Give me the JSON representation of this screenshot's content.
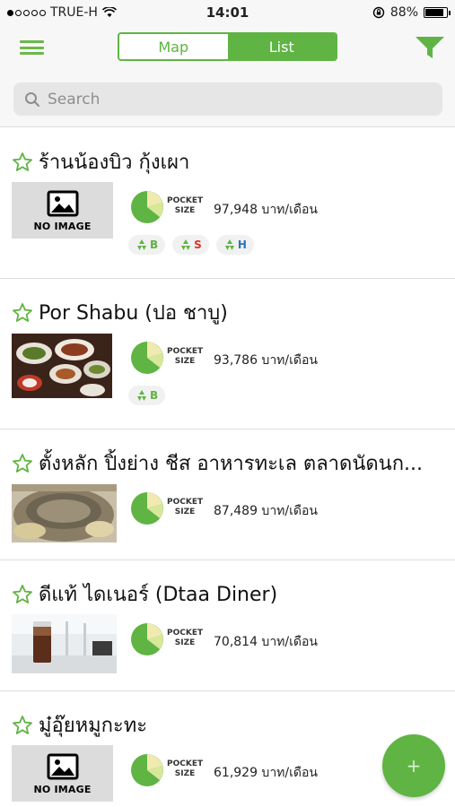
{
  "status_bar": {
    "carrier": "TRUE-H",
    "time": "14:01",
    "battery": "88%"
  },
  "nav": {
    "segment_map": "Map",
    "segment_list": "List",
    "selected_segment": "List",
    "accent_color": "#5fb443"
  },
  "search": {
    "placeholder": "Search"
  },
  "restaurants": [
    {
      "name": "ร้านน้องบิว กุ้งเผา",
      "image": "no-image",
      "no_image_label": "NO IMAGE",
      "pocket_label_1": "POCKET",
      "pocket_label_2": "SIZE",
      "price": "97,948 บาท/เดือน",
      "tags": [
        "B",
        "S",
        "H"
      ]
    },
    {
      "name": "Por Shabu (ปอ ชาบู)",
      "image": "food-photo",
      "pocket_label_1": "POCKET",
      "pocket_label_2": "SIZE",
      "price": "93,786 บาท/เดือน",
      "tags": [
        "B"
      ]
    },
    {
      "name": "ตั้งหลัก ปิ้งย่าง ชีส อาหารทะเล ตลาดนัดนก...",
      "image": "grill-photo",
      "pocket_label_1": "POCKET",
      "pocket_label_2": "SIZE",
      "price": "87,489 บาท/เดือน",
      "tags": []
    },
    {
      "name": "ดีแท้ ไดเนอร์ (Dtaa Diner)",
      "image": "cafe-photo",
      "pocket_label_1": "POCKET",
      "pocket_label_2": "SIZE",
      "price": "70,814 บาท/เดือน",
      "tags": []
    },
    {
      "name": "มู๋อุ๊ยหมูกะทะ",
      "image": "no-image",
      "no_image_label": "NO IMAGE",
      "pocket_label_1": "POCKET",
      "pocket_label_2": "SIZE",
      "price": "61,929 บาท/เดือน",
      "tags": []
    }
  ],
  "fab": {
    "label": "+"
  }
}
